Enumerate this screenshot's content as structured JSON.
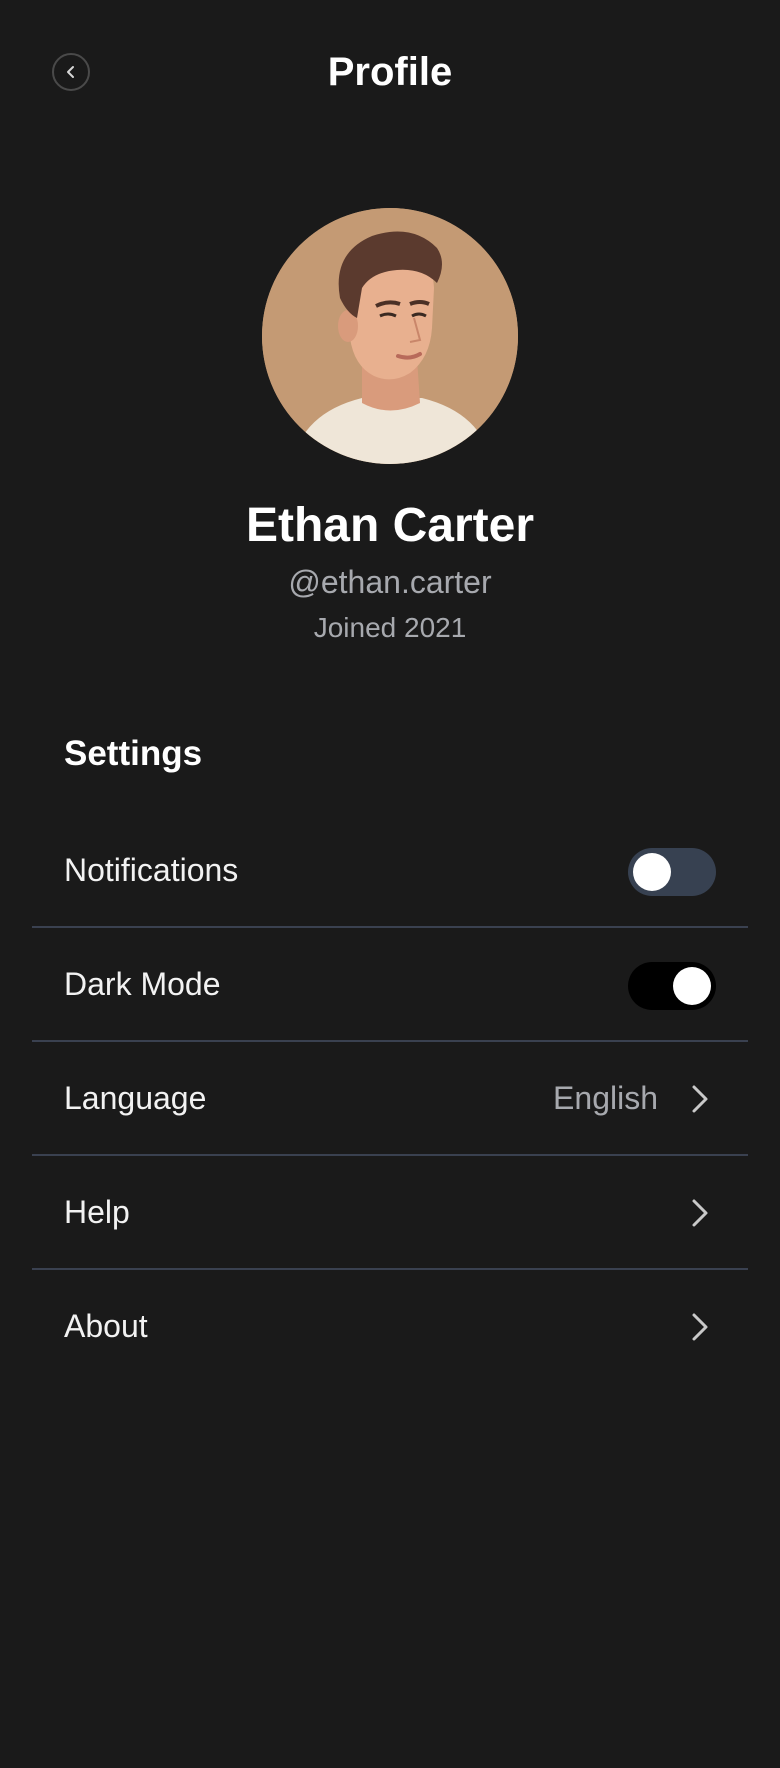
{
  "header": {
    "title": "Profile",
    "back_icon": "chevron-left-icon"
  },
  "profile": {
    "name": "Ethan Carter",
    "handle": "@ethan.carter",
    "joined": "Joined 2021",
    "avatar": "avatar-illustration"
  },
  "settings": {
    "title": "Settings",
    "items": [
      {
        "label": "Notifications",
        "type": "toggle",
        "on": false
      },
      {
        "label": "Dark Mode",
        "type": "toggle",
        "on": true
      },
      {
        "label": "Language",
        "type": "link",
        "value": "English",
        "icon": "chevron-right-icon"
      },
      {
        "label": "Help",
        "type": "link",
        "icon": "chevron-right-icon"
      },
      {
        "label": "About",
        "type": "link",
        "icon": "chevron-right-icon"
      }
    ]
  },
  "colors": {
    "background": "#1a1a1a",
    "toggle_off": "#374151",
    "toggle_on": "#000000",
    "divider": "#3a4150",
    "secondary_text": "#a7a9ae"
  }
}
